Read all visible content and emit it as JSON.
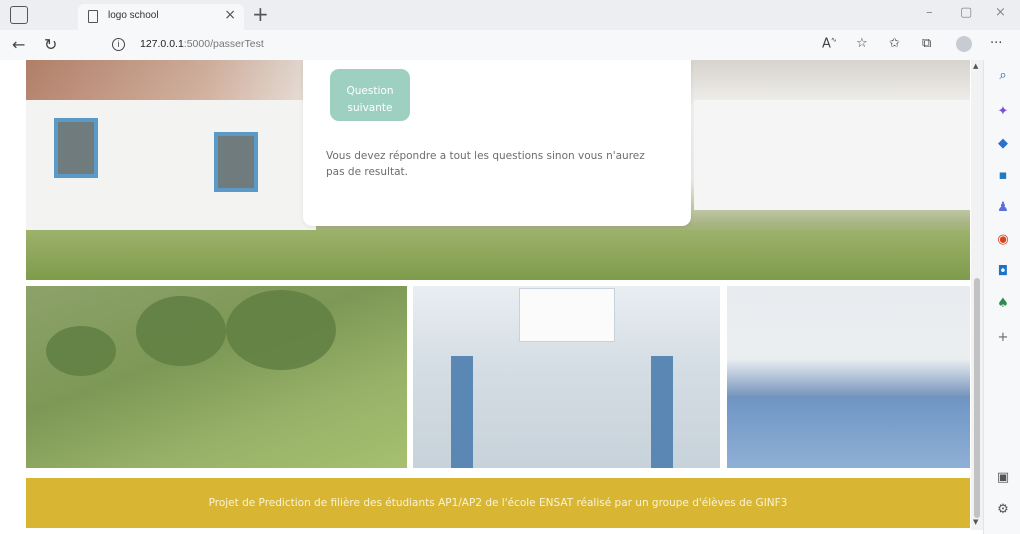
{
  "browser": {
    "tab_title": "logo school",
    "tab_close": "×",
    "new_tab": "+",
    "url_host": "127.0.0.1",
    "url_path": ":5000/passerTest",
    "window_controls": {
      "minimize": "–",
      "maximize": "▢",
      "close": "×"
    }
  },
  "card": {
    "button_label_line1": "Question",
    "button_label_line2": "suivante",
    "notice": "Vous devez répondre a tout les questions sinon vous n'aurez pas de resultat."
  },
  "footer": {
    "text": "Projet de Prediction de filière des étudiants AP1/AP2 de l'école ENSAT réalisé par un groupe d'élèves de GINF3"
  },
  "colors": {
    "button": "#9ed0c1",
    "footer": "#d8b634",
    "notice_text": "#6d6d6d"
  },
  "sidebar_icons": [
    "search-icon",
    "sparkle-icon",
    "tag-icon",
    "briefcase-icon",
    "people-icon",
    "office-icon",
    "outlook-icon",
    "tree-icon",
    "plus-icon",
    "panel-icon",
    "settings-icon"
  ]
}
